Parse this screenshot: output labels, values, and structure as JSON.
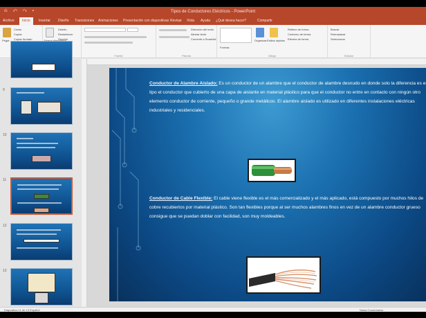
{
  "window": {
    "title": "Tipos de Conductores Eléctricos - PowerPoint",
    "quick_access": "⎌ ↶ ↷ ▾"
  },
  "ribbon_tabs": [
    {
      "label": "Archivo",
      "active": false
    },
    {
      "label": "Inicio",
      "active": true
    },
    {
      "label": "Insertar",
      "active": false
    },
    {
      "label": "Diseño",
      "active": false
    },
    {
      "label": "Transiciones",
      "active": false
    },
    {
      "label": "Animaciones",
      "active": false
    },
    {
      "label": "Presentación con diapositivas",
      "active": false
    },
    {
      "label": "Revisar",
      "active": false
    },
    {
      "label": "Vista",
      "active": false
    },
    {
      "label": "Ayuda",
      "active": false
    },
    {
      "label": "¿Qué desea hacer?",
      "active": false
    },
    {
      "label": "Compartir",
      "active": false
    }
  ],
  "ribbon": {
    "paste": "Pegar",
    "cut": "Cortar",
    "copy": "Copiar",
    "format_painter": "Copiar formato",
    "clipboard_group": "Portapapeles",
    "new_slide": "Nueva diapositiva",
    "layout": "Diseño",
    "reset": "Restablecer",
    "section": "Sección",
    "slides_group": "Diapositivas",
    "font_group": "Fuente",
    "paragraph_group": "Párrafo",
    "text_direction": "Dirección del texto",
    "align_text": "Alinear texto",
    "smartart": "Convertir a SmartArt",
    "shapes": "Formas",
    "arrange": "Organizar",
    "quick_styles": "Estilos rápidos",
    "shape_fill": "Relleno de forma",
    "shape_outline": "Contorno de forma",
    "shape_effects": "Efectos de forma",
    "drawing_group": "Dibujo",
    "find": "Buscar",
    "replace": "Reemplazar",
    "select": "Seleccionar",
    "editing_group": "Edición"
  },
  "thumbnails": [
    {
      "num": "",
      "selected": false
    },
    {
      "num": "9",
      "selected": false
    },
    {
      "num": "10",
      "selected": false
    },
    {
      "num": "11",
      "selected": true
    },
    {
      "num": "12",
      "selected": false
    },
    {
      "num": "13",
      "selected": false
    }
  ],
  "slide": {
    "para1_term": "Conductor de Alambre Aislado:",
    "para1_body": " Es un conductor de un alambre que el conductor de alambre desnudo en donde solo la diferencia es este tipo el conductor que cubierto de una capa de aislante en material plástico para que el conductor no entre en contacto con ningún otro elemento conductor de corriente, pequeño o grande metálicos. El alambre aislado es utilizado en diferentes instalaciones eléctricas industriales y residenciales.",
    "para2_term": "Conductor de Cable Flexible:",
    "para2_body": " El cable viene flexible es el más comercializado y el más aplicado, está compuesto por muchos hilos de cobre recubiertos por material plástico. Son tan flexibles porque al ser muchos alambres finos en vez de un alambre conductor grueso consigue que se puedan doblar con facilidad, son muy moldeables."
  },
  "status": {
    "left": "Diapositiva 11 de 13   Español",
    "right": "Notas   Comentarios"
  },
  "colors": {
    "accent": "#b7472a",
    "slide_bg": "#1b70b0"
  }
}
